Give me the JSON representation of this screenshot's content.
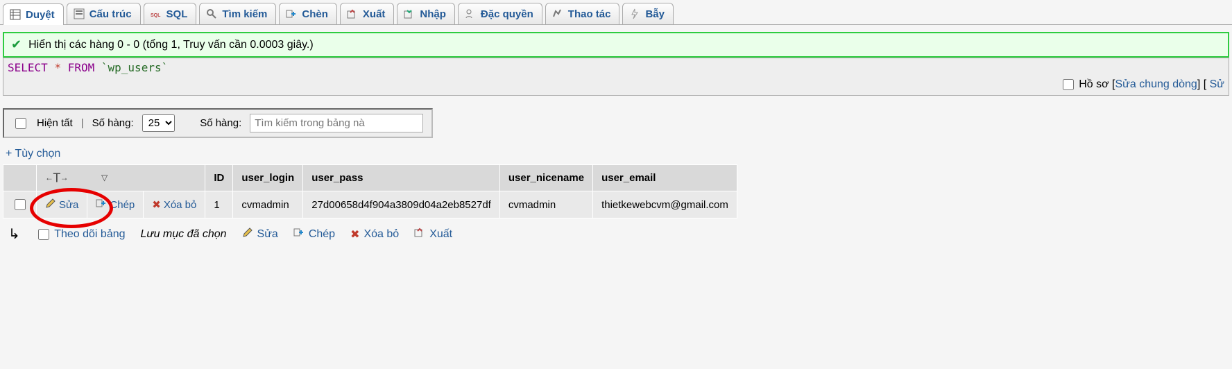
{
  "tabs": [
    {
      "id": "browse",
      "label": "Duyệt",
      "icon": "table"
    },
    {
      "id": "structure",
      "label": "Cấu trúc",
      "icon": "structure"
    },
    {
      "id": "sql",
      "label": "SQL",
      "icon": "sql"
    },
    {
      "id": "search",
      "label": "Tìm kiếm",
      "icon": "search"
    },
    {
      "id": "insert",
      "label": "Chèn",
      "icon": "insert"
    },
    {
      "id": "export",
      "label": "Xuất",
      "icon": "export"
    },
    {
      "id": "import",
      "label": "Nhập",
      "icon": "import"
    },
    {
      "id": "privileges",
      "label": "Đặc quyền",
      "icon": "privileges"
    },
    {
      "id": "operations",
      "label": "Thao tác",
      "icon": "operations"
    },
    {
      "id": "triggers",
      "label": "Bẫy",
      "icon": "triggers"
    }
  ],
  "success_msg": "Hiển thị các hàng 0 - 0 (tổng 1, Truy vấn cần 0.0003 giây.)",
  "sql": {
    "kw1": "SELECT",
    "star": "*",
    "kw2": "FROM",
    "table": "`wp_users`"
  },
  "sqlmeta": {
    "profile_label": "Hồ sơ",
    "edit_inline": "Sửa chung dòng",
    "edit_more": "Sử"
  },
  "toolbar": {
    "show_all": "Hiện tất",
    "rows_label": "Số hàng:",
    "rows_value": "25",
    "filter_label": "Số hàng:",
    "filter_placeholder": "Tìm kiếm trong bảng nà"
  },
  "options_link": "+ Tùy chọn",
  "table": {
    "headers": [
      "ID",
      "user_login",
      "user_pass",
      "user_nicename",
      "user_email"
    ],
    "row": {
      "edit": "Sửa",
      "copy": "Chép",
      "delete": "Xóa bỏ",
      "ID": "1",
      "user_login": "cvmadmin",
      "user_pass": "27d00658d4f904a3809d04a2eb8527df",
      "user_nicename": "cvmadmin",
      "user_email": "thietkewebcvm@gmail.com"
    }
  },
  "footer": {
    "check_all": "Theo dõi bảng",
    "with_selected": "Lưu mục đã chọn",
    "edit": "Sửa",
    "copy": "Chép",
    "delete": "Xóa bỏ",
    "export": "Xuất"
  }
}
